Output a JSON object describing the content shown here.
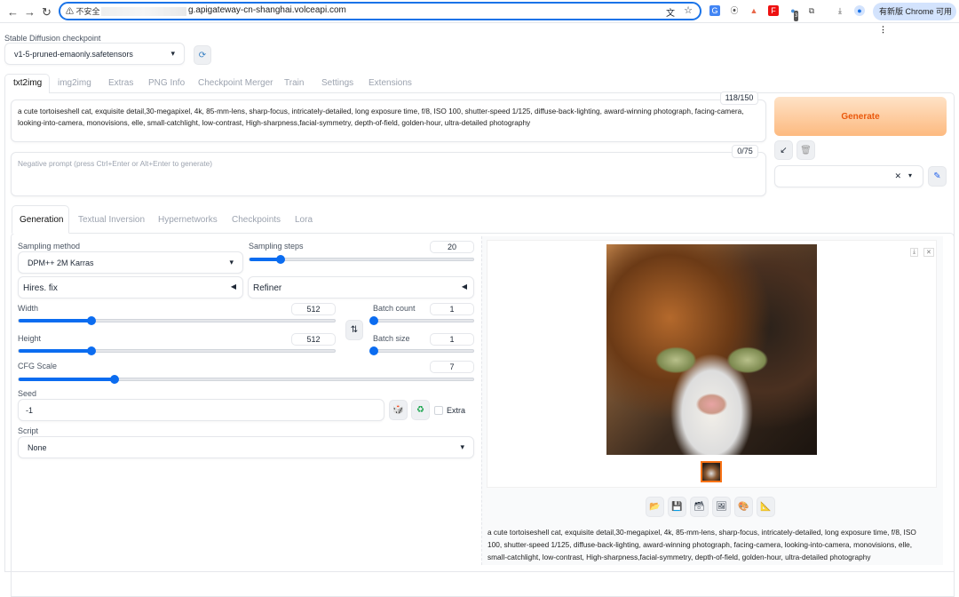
{
  "browser": {
    "security_label": "不安全",
    "url_host": "g.apigateway-cn-shanghai.volceapi.com",
    "update_label": "有新版 Chrome 可用",
    "ext_badge": "3"
  },
  "checkpoint": {
    "label": "Stable Diffusion checkpoint",
    "value": "v1-5-pruned-emaonly.safetensors"
  },
  "tabs": [
    "txt2img",
    "img2img",
    "Extras",
    "PNG Info",
    "Checkpoint Merger",
    "Train",
    "Settings",
    "Extensions"
  ],
  "prompt": {
    "value": "a cute tortoiseshell cat, exquisite detail,30-megapixel, 4k, 85-mm-lens, sharp-focus, intricately-detailed, long exposure time, f/8, ISO 100, shutter-speed 1/125, diffuse-back-lighting, award-winning photograph, facing-camera, looking-into-camera, monovisions, elle, small-catchlight, low-contrast, High-sharpness,facial-symmetry, depth-of-field, golden-hour, ultra-detailed photography",
    "counter": "118/150"
  },
  "negative": {
    "placeholder": "Negative prompt (press Ctrl+Enter or Alt+Enter to generate)",
    "counter": "0/75"
  },
  "generate_label": "Generate",
  "gen_tabs": [
    "Generation",
    "Textual Inversion",
    "Hypernetworks",
    "Checkpoints",
    "Lora"
  ],
  "sampling": {
    "method_label": "Sampling method",
    "method": "DPM++ 2M Karras",
    "steps_label": "Sampling steps",
    "steps": "20",
    "steps_frac": 0.14
  },
  "hires_label": "Hires. fix",
  "refiner_label": "Refiner",
  "width": {
    "label": "Width",
    "value": "512",
    "frac": 0.23
  },
  "height": {
    "label": "Height",
    "value": "512",
    "frac": 0.23
  },
  "batch_count": {
    "label": "Batch count",
    "value": "1",
    "frac": 0
  },
  "batch_size": {
    "label": "Batch size",
    "value": "1",
    "frac": 0
  },
  "cfg": {
    "label": "CFG Scale",
    "value": "7",
    "frac": 0.21
  },
  "seed": {
    "label": "Seed",
    "value": "-1",
    "extra_label": "Extra"
  },
  "script": {
    "label": "Script",
    "value": "None"
  },
  "output_info": "a cute tortoiseshell cat, exquisite detail,30-megapixel, 4k, 85-mm-lens, sharp-focus, intricately-detailed, long exposure time, f/8, ISO 100, shutter-speed 1/125, diffuse-back-lighting, award-winning photograph, facing-camera, looking-into-camera, monovisions, elle, small-catchlight, low-contrast, High-sharpness,facial-symmetry, depth-of-field, golden-hour, ultra-detailed photography",
  "colors": {
    "accent": "#0b6cf0",
    "generate_text": "#ea580c"
  }
}
